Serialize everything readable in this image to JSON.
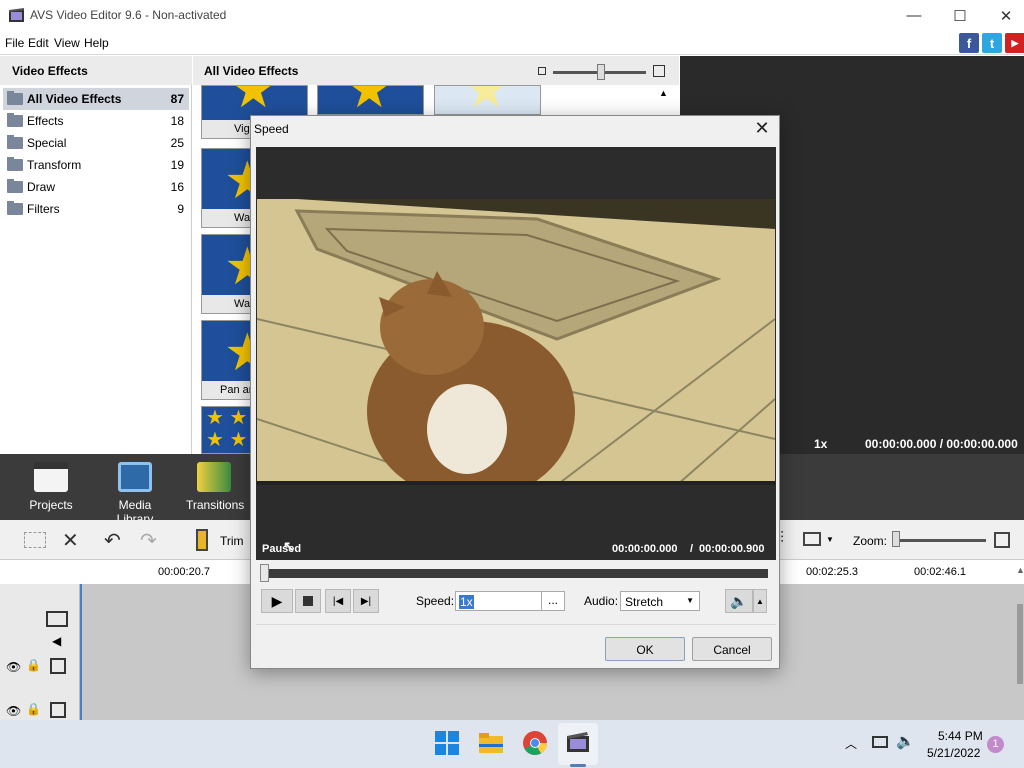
{
  "window": {
    "title": "AVS Video Editor 9.6 - Non-activated",
    "minimize": "—",
    "maximize": "☐",
    "close": "✕"
  },
  "menu": [
    "File",
    "Edit",
    "View",
    "Help"
  ],
  "social": [
    "f",
    "t",
    "▶"
  ],
  "left_panel": {
    "title": "Video Effects",
    "categories": [
      {
        "label": "All Video Effects",
        "count": "87",
        "selected": true
      },
      {
        "label": "Effects",
        "count": "18"
      },
      {
        "label": "Special",
        "count": "25"
      },
      {
        "label": "Transform",
        "count": "19"
      },
      {
        "label": "Draw",
        "count": "16"
      },
      {
        "label": "Filters",
        "count": "9"
      }
    ]
  },
  "effects_panel": {
    "title": "All Video Effects",
    "thumbs": [
      "Vign",
      "Warm",
      "Wate",
      "Pan ar"
    ]
  },
  "preview": {
    "speed": "1x",
    "time": "00:00:00.000 / 00:00:00.000"
  },
  "bottom_tabs": [
    "Projects",
    "Media Library",
    "Transitions"
  ],
  "timeline_toolbar": {
    "trim": "Trim",
    "zoom_label": "Zoom:"
  },
  "ruler": [
    "00:00:20.7",
    "00:02:25.3",
    "00:02:46.1"
  ],
  "dialog": {
    "title": "Speed",
    "status": "Paused",
    "time": "00:00:00.000",
    "duration": "00:00:00.900",
    "speed_label": "Speed:",
    "speed_value": "1x",
    "speed_more": "...",
    "audio_label": "Audio:",
    "audio_value": "Stretch",
    "ok": "OK",
    "cancel": "Cancel"
  },
  "taskbar": {
    "time": "5:44 PM",
    "date": "5/21/2022",
    "notification_count": "1"
  },
  "colors": {
    "accent": "#1f4f9a",
    "dark_panel": "#2a2a2a",
    "bottom_bar": "#3b3b3b",
    "selection": "#cfd4dd",
    "taskbar": "#dfe5ee"
  }
}
